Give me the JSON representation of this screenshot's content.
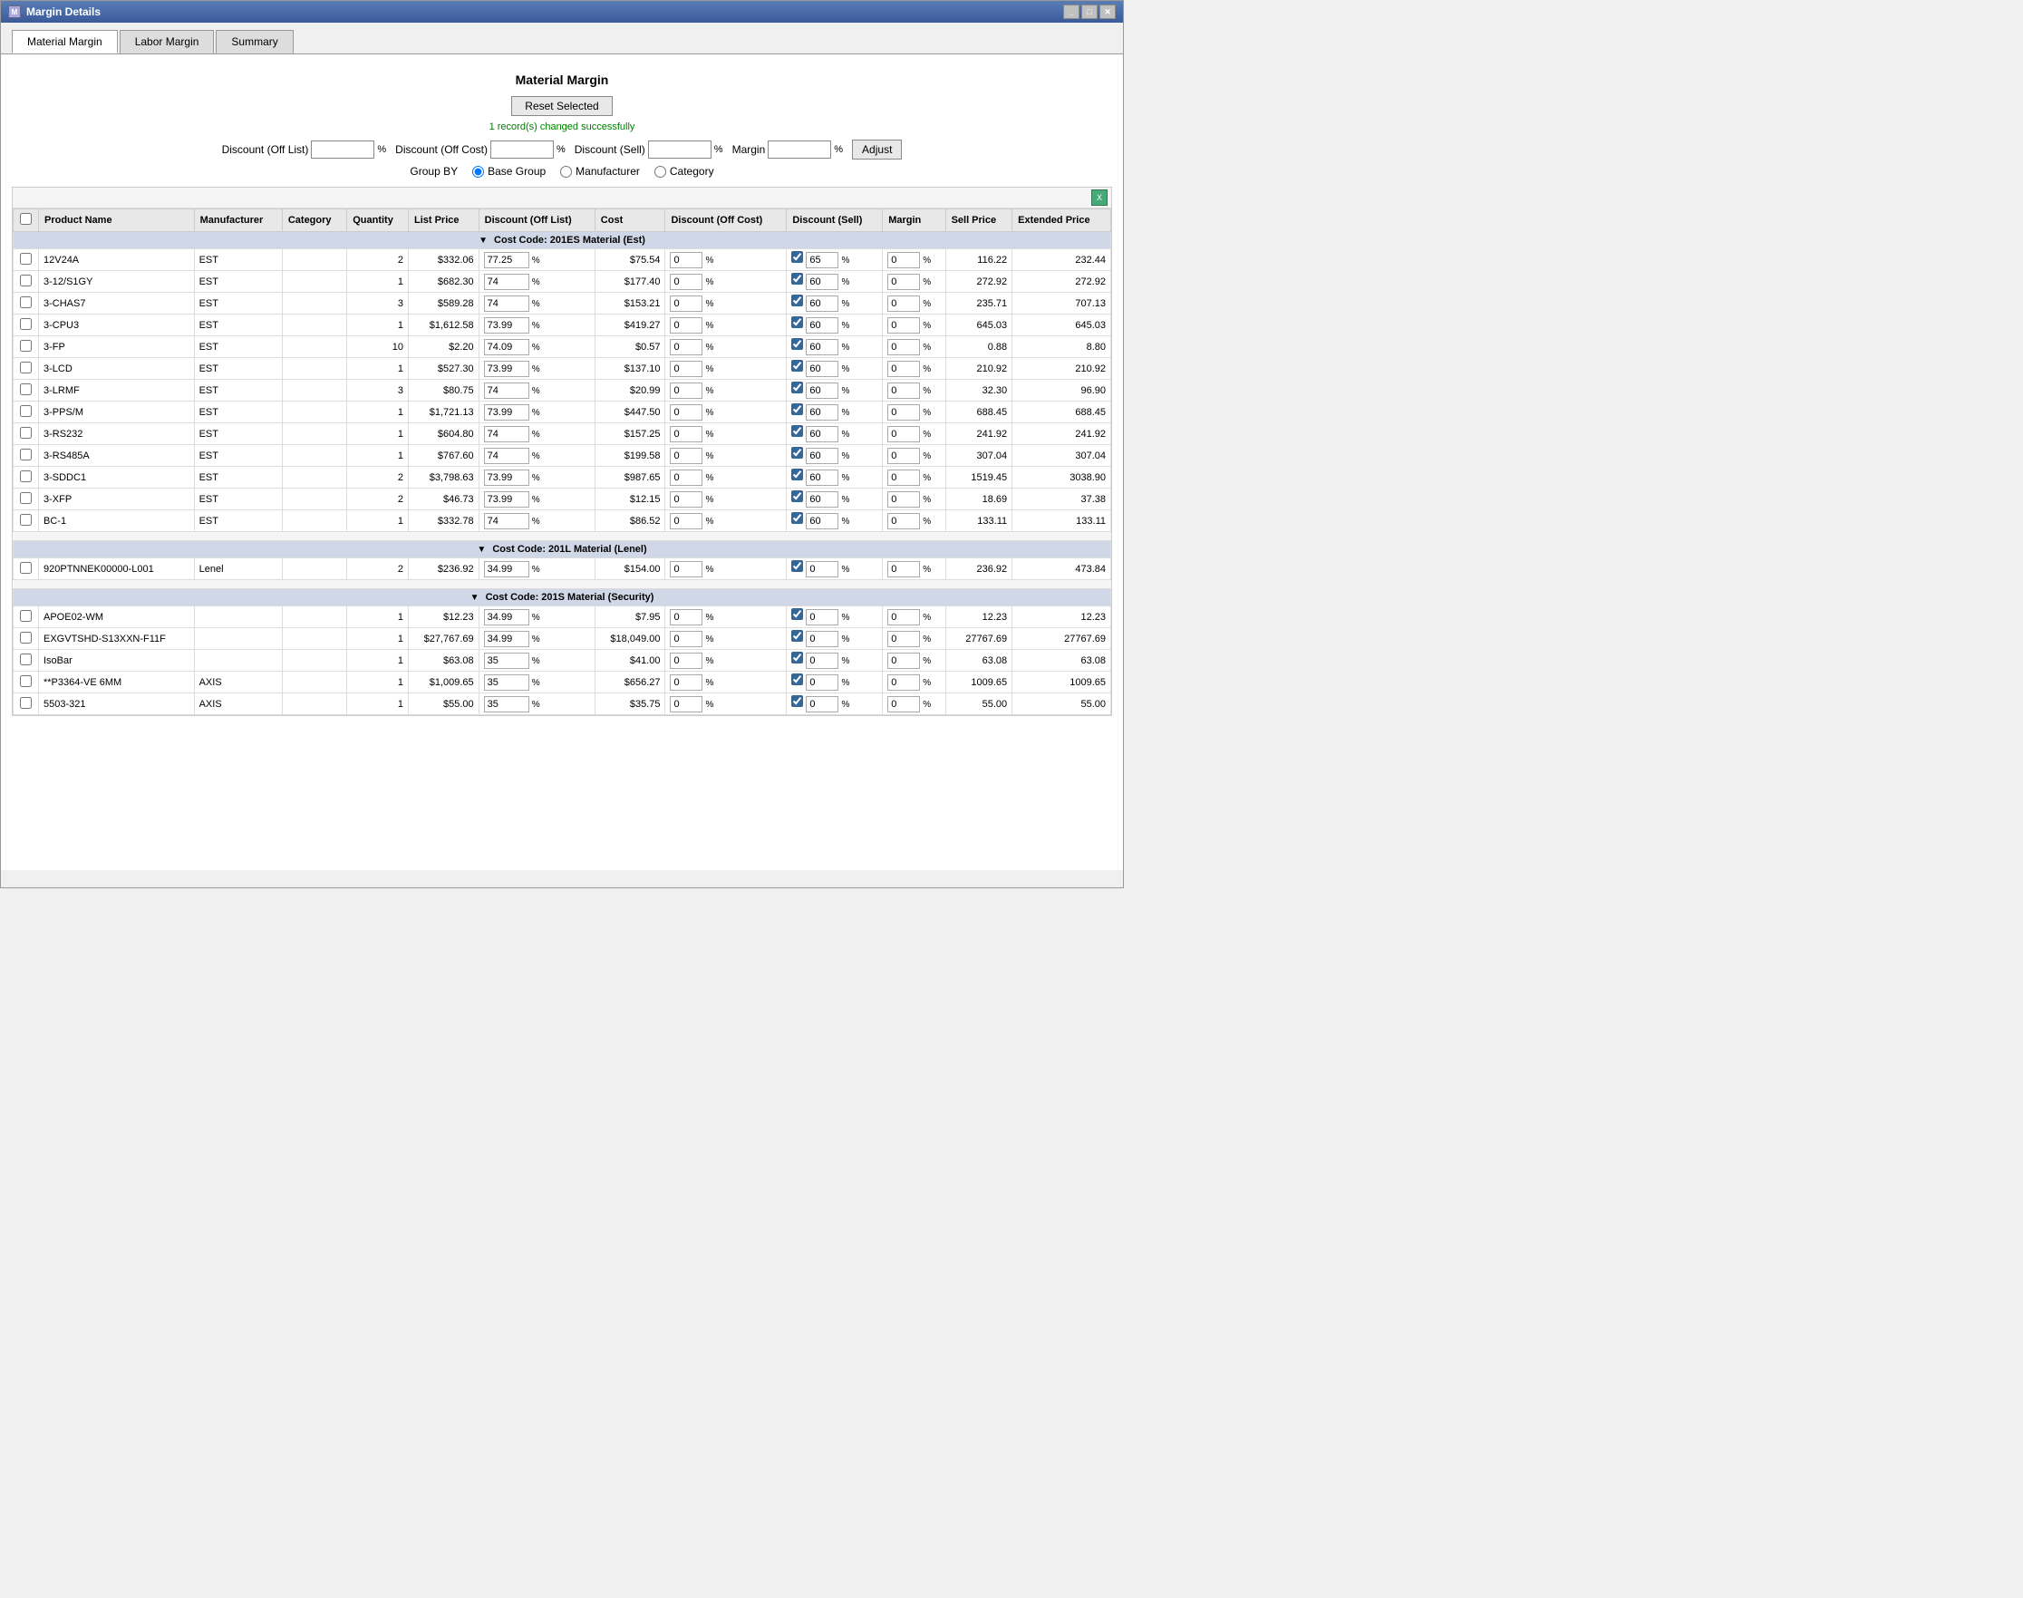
{
  "window": {
    "title": "Margin Details",
    "icon": "M"
  },
  "tabs": [
    {
      "id": "material",
      "label": "Material Margin",
      "active": true
    },
    {
      "id": "labor",
      "label": "Labor Margin",
      "active": false
    },
    {
      "id": "summary",
      "label": "Summary",
      "active": false
    }
  ],
  "page": {
    "title": "Material Margin",
    "reset_btn": "Reset Selected",
    "success_msg": "1 record(s) changed successfully",
    "discount_off_list_label": "Discount (Off List)",
    "discount_off_cost_label": "Discount (Off Cost)",
    "discount_sell_label": "Discount (Sell)",
    "margin_label": "Margin",
    "pct_symbol": "%",
    "adjust_btn": "Adjust",
    "group_by_label": "Group BY",
    "group_by_options": [
      {
        "id": "base_group",
        "label": "Base Group",
        "checked": true
      },
      {
        "id": "manufacturer",
        "label": "Manufacturer",
        "checked": false
      },
      {
        "id": "category",
        "label": "Category",
        "checked": false
      }
    ]
  },
  "columns": [
    {
      "id": "checkbox",
      "label": ""
    },
    {
      "id": "product_name",
      "label": "Product Name"
    },
    {
      "id": "manufacturer",
      "label": "Manufacturer"
    },
    {
      "id": "category",
      "label": "Category"
    },
    {
      "id": "quantity",
      "label": "Quantity"
    },
    {
      "id": "list_price",
      "label": "List Price"
    },
    {
      "id": "discount_off_list",
      "label": "Discount (Off List)"
    },
    {
      "id": "cost",
      "label": "Cost"
    },
    {
      "id": "discount_off_cost",
      "label": "Discount (Off Cost)"
    },
    {
      "id": "discount_sell",
      "label": "Discount (Sell)"
    },
    {
      "id": "margin",
      "label": "Margin"
    },
    {
      "id": "sell_price",
      "label": "Sell Price"
    },
    {
      "id": "extended_price",
      "label": "Extended Price"
    }
  ],
  "groups": [
    {
      "id": "201ES",
      "label": "Cost Code: 201ES Material (Est)",
      "rows": [
        {
          "product": "12V24A",
          "manufacturer": "EST",
          "category": "",
          "qty": "2",
          "list_price": "$332.06",
          "disc_off_list": "77.25",
          "cost": "$75.54",
          "disc_off_cost": "0",
          "disc_sell_checked": true,
          "disc_sell": "65",
          "margin": "0",
          "sell_price": "116.22",
          "extended_price": "232.44"
        },
        {
          "product": "3-12/S1GY",
          "manufacturer": "EST",
          "category": "",
          "qty": "1",
          "list_price": "$682.30",
          "disc_off_list": "74",
          "cost": "$177.40",
          "disc_off_cost": "0",
          "disc_sell_checked": true,
          "disc_sell": "60",
          "margin": "0",
          "sell_price": "272.92",
          "extended_price": "272.92"
        },
        {
          "product": "3-CHAS7",
          "manufacturer": "EST",
          "category": "",
          "qty": "3",
          "list_price": "$589.28",
          "disc_off_list": "74",
          "cost": "$153.21",
          "disc_off_cost": "0",
          "disc_sell_checked": true,
          "disc_sell": "60",
          "margin": "0",
          "sell_price": "235.71",
          "extended_price": "707.13"
        },
        {
          "product": "3-CPU3",
          "manufacturer": "EST",
          "category": "",
          "qty": "1",
          "list_price": "$1,612.58",
          "disc_off_list": "73.99",
          "cost": "$419.27",
          "disc_off_cost": "0",
          "disc_sell_checked": true,
          "disc_sell": "60",
          "margin": "0",
          "sell_price": "645.03",
          "extended_price": "645.03"
        },
        {
          "product": "3-FP",
          "manufacturer": "EST",
          "category": "",
          "qty": "10",
          "list_price": "$2.20",
          "disc_off_list": "74.09",
          "cost": "$0.57",
          "disc_off_cost": "0",
          "disc_sell_checked": true,
          "disc_sell": "60",
          "margin": "0",
          "sell_price": "0.88",
          "extended_price": "8.80"
        },
        {
          "product": "3-LCD",
          "manufacturer": "EST",
          "category": "",
          "qty": "1",
          "list_price": "$527.30",
          "disc_off_list": "73.99",
          "cost": "$137.10",
          "disc_off_cost": "0",
          "disc_sell_checked": true,
          "disc_sell": "60",
          "margin": "0",
          "sell_price": "210.92",
          "extended_price": "210.92"
        },
        {
          "product": "3-LRMF",
          "manufacturer": "EST",
          "category": "",
          "qty": "3",
          "list_price": "$80.75",
          "disc_off_list": "74",
          "cost": "$20.99",
          "disc_off_cost": "0",
          "disc_sell_checked": true,
          "disc_sell": "60",
          "margin": "0",
          "sell_price": "32.30",
          "extended_price": "96.90"
        },
        {
          "product": "3-PPS/M",
          "manufacturer": "EST",
          "category": "",
          "qty": "1",
          "list_price": "$1,721.13",
          "disc_off_list": "73.99",
          "cost": "$447.50",
          "disc_off_cost": "0",
          "disc_sell_checked": true,
          "disc_sell": "60",
          "margin": "0",
          "sell_price": "688.45",
          "extended_price": "688.45"
        },
        {
          "product": "3-RS232",
          "manufacturer": "EST",
          "category": "",
          "qty": "1",
          "list_price": "$604.80",
          "disc_off_list": "74",
          "cost": "$157.25",
          "disc_off_cost": "0",
          "disc_sell_checked": true,
          "disc_sell": "60",
          "margin": "0",
          "sell_price": "241.92",
          "extended_price": "241.92"
        },
        {
          "product": "3-RS485A",
          "manufacturer": "EST",
          "category": "",
          "qty": "1",
          "list_price": "$767.60",
          "disc_off_list": "74",
          "cost": "$199.58",
          "disc_off_cost": "0",
          "disc_sell_checked": true,
          "disc_sell": "60",
          "margin": "0",
          "sell_price": "307.04",
          "extended_price": "307.04"
        },
        {
          "product": "3-SDDC1",
          "manufacturer": "EST",
          "category": "",
          "qty": "2",
          "list_price": "$3,798.63",
          "disc_off_list": "73.99",
          "cost": "$987.65",
          "disc_off_cost": "0",
          "disc_sell_checked": true,
          "disc_sell": "60",
          "margin": "0",
          "sell_price": "1519.45",
          "extended_price": "3038.90"
        },
        {
          "product": "3-XFP",
          "manufacturer": "EST",
          "category": "",
          "qty": "2",
          "list_price": "$46.73",
          "disc_off_list": "73.99",
          "cost": "$12.15",
          "disc_off_cost": "0",
          "disc_sell_checked": true,
          "disc_sell": "60",
          "margin": "0",
          "sell_price": "18.69",
          "extended_price": "37.38"
        },
        {
          "product": "BC-1",
          "manufacturer": "EST",
          "category": "",
          "qty": "1",
          "list_price": "$332.78",
          "disc_off_list": "74",
          "cost": "$86.52",
          "disc_off_cost": "0",
          "disc_sell_checked": true,
          "disc_sell": "60",
          "margin": "0",
          "sell_price": "133.11",
          "extended_price": "133.11"
        }
      ]
    },
    {
      "id": "201L",
      "label": "Cost Code: 201L Material (Lenel)",
      "rows": [
        {
          "product": "920PTNNEK00000-L001",
          "manufacturer": "Lenel",
          "category": "",
          "qty": "2",
          "list_price": "$236.92",
          "disc_off_list": "34.99",
          "cost": "$154.00",
          "disc_off_cost": "0",
          "disc_sell_checked": true,
          "disc_sell": "0",
          "margin": "0",
          "sell_price": "236.92",
          "extended_price": "473.84"
        }
      ]
    },
    {
      "id": "201S",
      "label": "Cost Code: 201S Material (Security)",
      "rows": [
        {
          "product": "APOE02-WM",
          "manufacturer": "",
          "category": "",
          "qty": "1",
          "list_price": "$12.23",
          "disc_off_list": "34.99",
          "cost": "$7.95",
          "disc_off_cost": "0",
          "disc_sell_checked": true,
          "disc_sell": "0",
          "margin": "0",
          "sell_price": "12.23",
          "extended_price": "12.23"
        },
        {
          "product": "EXGVTSHD-S13XXN-F11F",
          "manufacturer": "",
          "category": "",
          "qty": "1",
          "list_price": "$27,767.69",
          "disc_off_list": "34.99",
          "cost": "$18,049.00",
          "disc_off_cost": "0",
          "disc_sell_checked": true,
          "disc_sell": "0",
          "margin": "0",
          "sell_price": "27767.69",
          "extended_price": "27767.69"
        },
        {
          "product": "IsoBar",
          "manufacturer": "",
          "category": "",
          "qty": "1",
          "list_price": "$63.08",
          "disc_off_list": "35",
          "cost": "$41.00",
          "disc_off_cost": "0",
          "disc_sell_checked": true,
          "disc_sell": "0",
          "margin": "0",
          "sell_price": "63.08",
          "extended_price": "63.08"
        },
        {
          "product": "**P3364-VE 6MM",
          "manufacturer": "AXIS",
          "category": "",
          "qty": "1",
          "list_price": "$1,009.65",
          "disc_off_list": "35",
          "cost": "$656.27",
          "disc_off_cost": "0",
          "disc_sell_checked": true,
          "disc_sell": "0",
          "margin": "0",
          "sell_price": "1009.65",
          "extended_price": "1009.65"
        },
        {
          "product": "5503-321",
          "manufacturer": "AXIS",
          "category": "",
          "qty": "1",
          "list_price": "$55.00",
          "disc_off_list": "35",
          "cost": "$35.75",
          "disc_off_cost": "0",
          "disc_sell_checked": true,
          "disc_sell": "0",
          "margin": "0",
          "sell_price": "55.00",
          "extended_price": "55.00"
        }
      ]
    }
  ]
}
